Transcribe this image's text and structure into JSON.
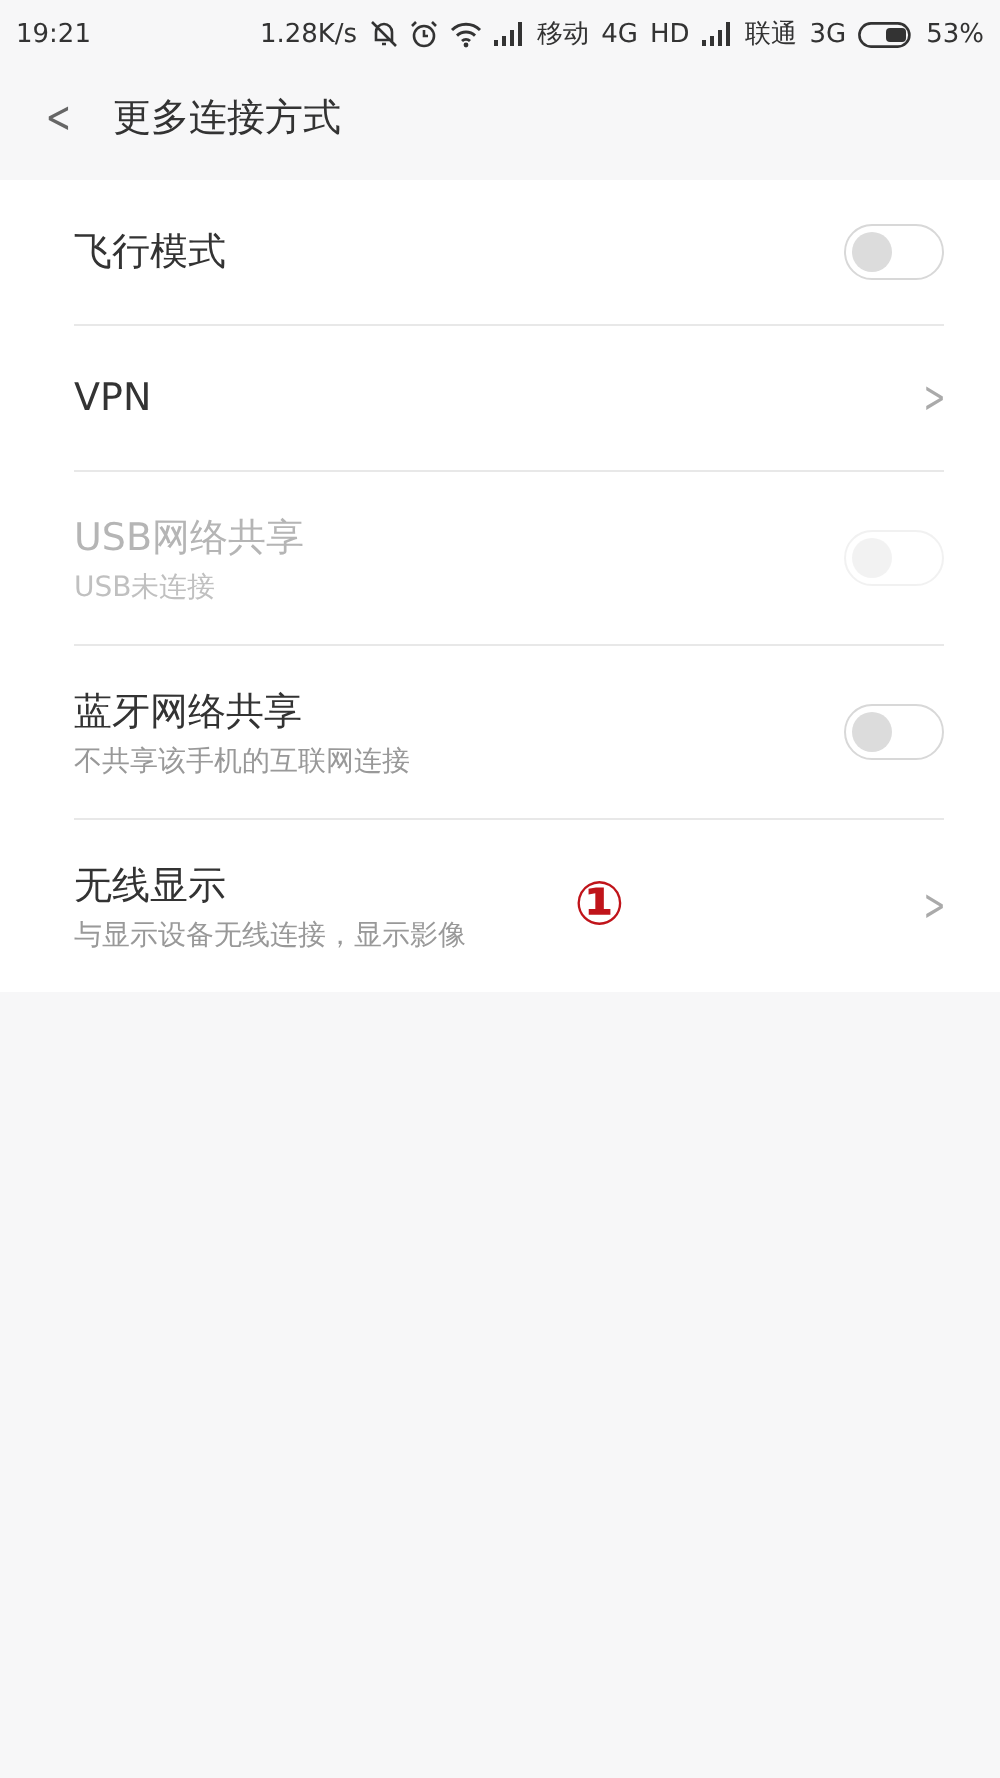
{
  "status_bar": {
    "time": "19:21",
    "speed": "1.28K/s",
    "carrier_1": "移动",
    "network_1": "4G",
    "hd": "HD",
    "carrier_2": "联通",
    "network_2": "3G",
    "battery": "53%"
  },
  "header": {
    "back": "<",
    "title": "更多连接方式"
  },
  "rows": [
    {
      "kind": "switch",
      "title": "飞行模式",
      "on": false,
      "disabled": false
    },
    {
      "kind": "link",
      "title": "VPN",
      "chevron": ">"
    },
    {
      "kind": "switch",
      "title": "USB网络共享",
      "subtitle": "USB未连接",
      "on": false,
      "disabled": true
    },
    {
      "kind": "switch",
      "title": "蓝牙网络共享",
      "subtitle": "不共享该手机的互联网连接",
      "on": false,
      "disabled": false
    },
    {
      "kind": "link",
      "title": "无线显示",
      "subtitle": "与显示设备无线连接，显示影像",
      "chevron": ">",
      "annotation": "①"
    }
  ]
}
